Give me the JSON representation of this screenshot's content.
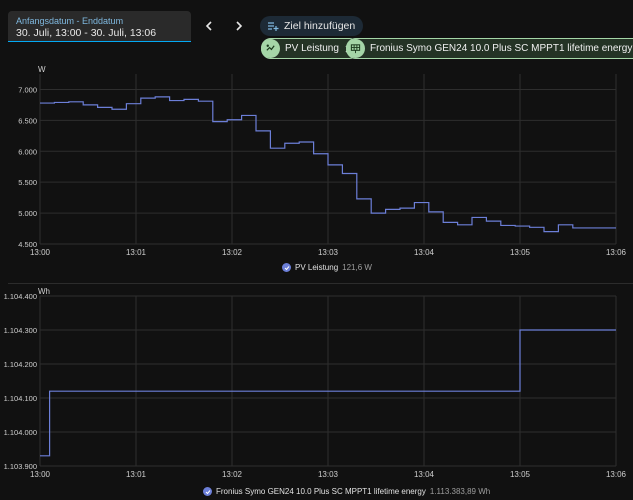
{
  "header": {
    "date_range": {
      "label": "Anfangsdatum - Enddatum",
      "value": "30. Juli, 13:00 - 30. Juli, 13:06"
    },
    "prev_icon": "chevron-left-icon",
    "next_icon": "chevron-right-icon",
    "add_target_label": "Ziel hinzufügen",
    "chips": [
      {
        "label": "PV Leistung",
        "icon": "solar-power-icon"
      },
      {
        "label": "Fronius Symo GEN24 10.0 Plus SC MPPT1 lifetime energy",
        "icon": "solar-panel-icon"
      }
    ]
  },
  "colors": {
    "accent": "#03a9f4",
    "line": "#6c7fd8",
    "chip_border": "#a5d6a7",
    "background": "#111111"
  },
  "chart_data": [
    {
      "type": "line",
      "step": true,
      "ylabel": "W",
      "x_ticks": [
        "13:00",
        "13:01",
        "13:02",
        "13:03",
        "13:04",
        "13:05",
        "13:06"
      ],
      "y_ticks": [
        "4.500",
        "5.000",
        "5.500",
        "6.000",
        "6.500",
        "7.000"
      ],
      "y_tick_values": [
        4500,
        5000,
        5500,
        6000,
        6500,
        7000
      ],
      "ylim": [
        4500,
        7250
      ],
      "xlim": [
        0,
        6
      ],
      "grid": true,
      "legend": {
        "name": "PV Leistung",
        "value": "121,6 W",
        "position": "bottom-center"
      },
      "series": [
        {
          "name": "PV Leistung",
          "x": [
            0,
            0.15,
            0.3,
            0.45,
            0.6,
            0.75,
            0.9,
            1.05,
            1.2,
            1.35,
            1.5,
            1.65,
            1.8,
            1.95,
            2.1,
            2.25,
            2.4,
            2.55,
            2.7,
            2.85,
            3.0,
            3.15,
            3.3,
            3.45,
            3.6,
            3.75,
            3.9,
            4.05,
            4.2,
            4.35,
            4.5,
            4.65,
            4.8,
            4.95,
            5.1,
            5.25,
            5.4,
            5.55,
            5.7,
            5.85,
            6.0
          ],
          "y": [
            6780,
            6790,
            6800,
            6750,
            6710,
            6680,
            6770,
            6860,
            6880,
            6820,
            6840,
            6810,
            6480,
            6510,
            6580,
            6330,
            6050,
            6130,
            6150,
            5960,
            5780,
            5640,
            5230,
            5000,
            5060,
            5080,
            5170,
            5020,
            4850,
            4810,
            4930,
            4870,
            4800,
            4790,
            4770,
            4700,
            4810,
            4760,
            4760,
            4760,
            4760
          ]
        }
      ]
    },
    {
      "type": "line",
      "step": true,
      "ylabel": "Wh",
      "x_ticks": [
        "13:00",
        "13:01",
        "13:02",
        "13:03",
        "13:04",
        "13:05",
        "13:06"
      ],
      "y_ticks": [
        "1.103.900",
        "1.104.000",
        "1.104.100",
        "1.104.200",
        "1.104.300",
        "1.104.400"
      ],
      "y_tick_values": [
        1103900,
        1104000,
        1104100,
        1104200,
        1104300,
        1104400
      ],
      "ylim": [
        1103900,
        1104400
      ],
      "xlim": [
        0,
        6
      ],
      "grid": true,
      "legend": {
        "name": "Fronius Symo GEN24 10.0 Plus SC MPPT1 lifetime energy",
        "value": "1.113.383,89 Wh",
        "position": "bottom-center"
      },
      "series": [
        {
          "name": "Fronius Symo GEN24 10.0 Plus SC MPPT1 lifetime energy",
          "x": [
            0,
            0.1,
            5.0,
            6.0
          ],
          "y": [
            1103930,
            1104120,
            1104300,
            1104300
          ]
        }
      ]
    }
  ]
}
